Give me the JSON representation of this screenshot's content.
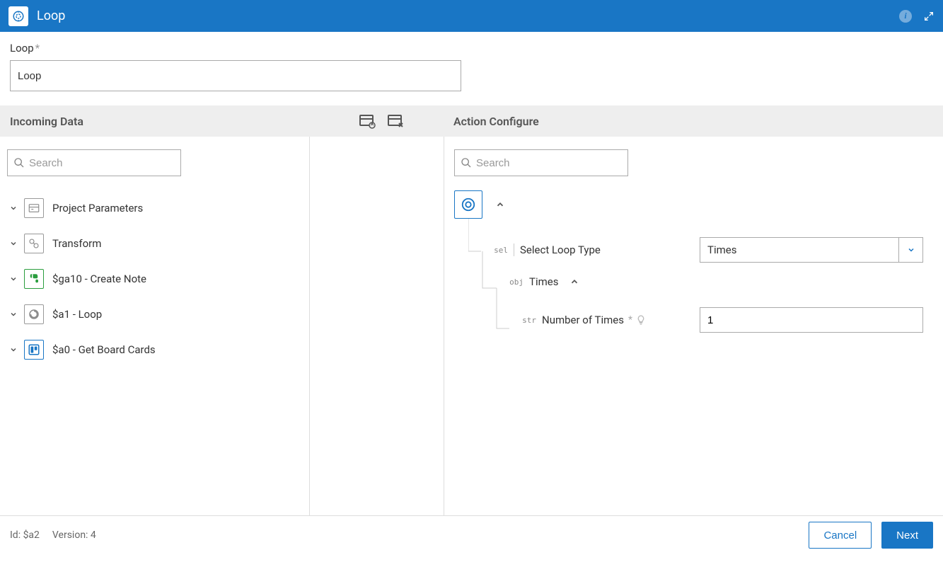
{
  "header": {
    "title": "Loop"
  },
  "form": {
    "name_label": "Loop",
    "name_value": "Loop"
  },
  "sections": {
    "incoming": "Incoming Data",
    "action": "Action Configure"
  },
  "search": {
    "placeholder": "Search"
  },
  "incoming_items": [
    {
      "label": "Project Parameters",
      "icon": "params"
    },
    {
      "label": "Transform",
      "icon": "transform"
    },
    {
      "label": "$ga10 - Create Note",
      "icon": "evernote"
    },
    {
      "label": "$a1 - Loop",
      "icon": "loop"
    },
    {
      "label": "$a0 - Get Board Cards",
      "icon": "trello"
    }
  ],
  "config": {
    "select_loop_type": {
      "type": "sel",
      "label": "Select Loop Type",
      "value": "Times"
    },
    "times": {
      "type": "obj",
      "label": "Times"
    },
    "number_of_times": {
      "type": "str",
      "label": "Number of Times",
      "value": "1"
    }
  },
  "footer": {
    "id_label": "Id: $a2",
    "version_label": "Version: 4",
    "cancel": "Cancel",
    "next": "Next"
  }
}
